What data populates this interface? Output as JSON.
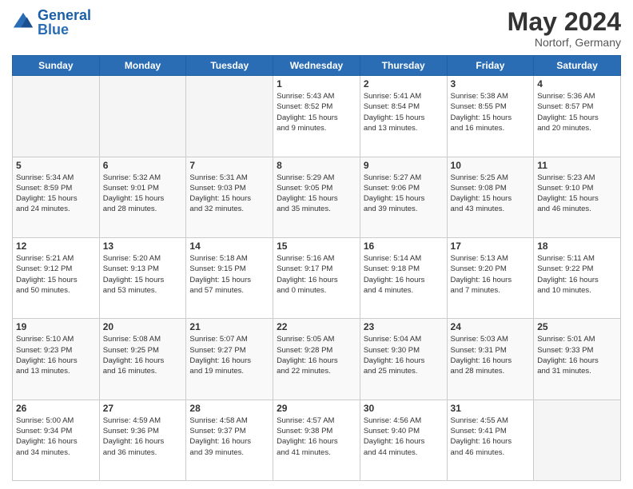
{
  "header": {
    "logo_general": "General",
    "logo_blue": "Blue",
    "month_year": "May 2024",
    "location": "Nortorf, Germany"
  },
  "days_of_week": [
    "Sunday",
    "Monday",
    "Tuesday",
    "Wednesday",
    "Thursday",
    "Friday",
    "Saturday"
  ],
  "weeks": [
    [
      {
        "day": "",
        "info": ""
      },
      {
        "day": "",
        "info": ""
      },
      {
        "day": "",
        "info": ""
      },
      {
        "day": "1",
        "info": "Sunrise: 5:43 AM\nSunset: 8:52 PM\nDaylight: 15 hours\nand 9 minutes."
      },
      {
        "day": "2",
        "info": "Sunrise: 5:41 AM\nSunset: 8:54 PM\nDaylight: 15 hours\nand 13 minutes."
      },
      {
        "day": "3",
        "info": "Sunrise: 5:38 AM\nSunset: 8:55 PM\nDaylight: 15 hours\nand 16 minutes."
      },
      {
        "day": "4",
        "info": "Sunrise: 5:36 AM\nSunset: 8:57 PM\nDaylight: 15 hours\nand 20 minutes."
      }
    ],
    [
      {
        "day": "5",
        "info": "Sunrise: 5:34 AM\nSunset: 8:59 PM\nDaylight: 15 hours\nand 24 minutes."
      },
      {
        "day": "6",
        "info": "Sunrise: 5:32 AM\nSunset: 9:01 PM\nDaylight: 15 hours\nand 28 minutes."
      },
      {
        "day": "7",
        "info": "Sunrise: 5:31 AM\nSunset: 9:03 PM\nDaylight: 15 hours\nand 32 minutes."
      },
      {
        "day": "8",
        "info": "Sunrise: 5:29 AM\nSunset: 9:05 PM\nDaylight: 15 hours\nand 35 minutes."
      },
      {
        "day": "9",
        "info": "Sunrise: 5:27 AM\nSunset: 9:06 PM\nDaylight: 15 hours\nand 39 minutes."
      },
      {
        "day": "10",
        "info": "Sunrise: 5:25 AM\nSunset: 9:08 PM\nDaylight: 15 hours\nand 43 minutes."
      },
      {
        "day": "11",
        "info": "Sunrise: 5:23 AM\nSunset: 9:10 PM\nDaylight: 15 hours\nand 46 minutes."
      }
    ],
    [
      {
        "day": "12",
        "info": "Sunrise: 5:21 AM\nSunset: 9:12 PM\nDaylight: 15 hours\nand 50 minutes."
      },
      {
        "day": "13",
        "info": "Sunrise: 5:20 AM\nSunset: 9:13 PM\nDaylight: 15 hours\nand 53 minutes."
      },
      {
        "day": "14",
        "info": "Sunrise: 5:18 AM\nSunset: 9:15 PM\nDaylight: 15 hours\nand 57 minutes."
      },
      {
        "day": "15",
        "info": "Sunrise: 5:16 AM\nSunset: 9:17 PM\nDaylight: 16 hours\nand 0 minutes."
      },
      {
        "day": "16",
        "info": "Sunrise: 5:14 AM\nSunset: 9:18 PM\nDaylight: 16 hours\nand 4 minutes."
      },
      {
        "day": "17",
        "info": "Sunrise: 5:13 AM\nSunset: 9:20 PM\nDaylight: 16 hours\nand 7 minutes."
      },
      {
        "day": "18",
        "info": "Sunrise: 5:11 AM\nSunset: 9:22 PM\nDaylight: 16 hours\nand 10 minutes."
      }
    ],
    [
      {
        "day": "19",
        "info": "Sunrise: 5:10 AM\nSunset: 9:23 PM\nDaylight: 16 hours\nand 13 minutes."
      },
      {
        "day": "20",
        "info": "Sunrise: 5:08 AM\nSunset: 9:25 PM\nDaylight: 16 hours\nand 16 minutes."
      },
      {
        "day": "21",
        "info": "Sunrise: 5:07 AM\nSunset: 9:27 PM\nDaylight: 16 hours\nand 19 minutes."
      },
      {
        "day": "22",
        "info": "Sunrise: 5:05 AM\nSunset: 9:28 PM\nDaylight: 16 hours\nand 22 minutes."
      },
      {
        "day": "23",
        "info": "Sunrise: 5:04 AM\nSunset: 9:30 PM\nDaylight: 16 hours\nand 25 minutes."
      },
      {
        "day": "24",
        "info": "Sunrise: 5:03 AM\nSunset: 9:31 PM\nDaylight: 16 hours\nand 28 minutes."
      },
      {
        "day": "25",
        "info": "Sunrise: 5:01 AM\nSunset: 9:33 PM\nDaylight: 16 hours\nand 31 minutes."
      }
    ],
    [
      {
        "day": "26",
        "info": "Sunrise: 5:00 AM\nSunset: 9:34 PM\nDaylight: 16 hours\nand 34 minutes."
      },
      {
        "day": "27",
        "info": "Sunrise: 4:59 AM\nSunset: 9:36 PM\nDaylight: 16 hours\nand 36 minutes."
      },
      {
        "day": "28",
        "info": "Sunrise: 4:58 AM\nSunset: 9:37 PM\nDaylight: 16 hours\nand 39 minutes."
      },
      {
        "day": "29",
        "info": "Sunrise: 4:57 AM\nSunset: 9:38 PM\nDaylight: 16 hours\nand 41 minutes."
      },
      {
        "day": "30",
        "info": "Sunrise: 4:56 AM\nSunset: 9:40 PM\nDaylight: 16 hours\nand 44 minutes."
      },
      {
        "day": "31",
        "info": "Sunrise: 4:55 AM\nSunset: 9:41 PM\nDaylight: 16 hours\nand 46 minutes."
      },
      {
        "day": "",
        "info": ""
      }
    ]
  ]
}
